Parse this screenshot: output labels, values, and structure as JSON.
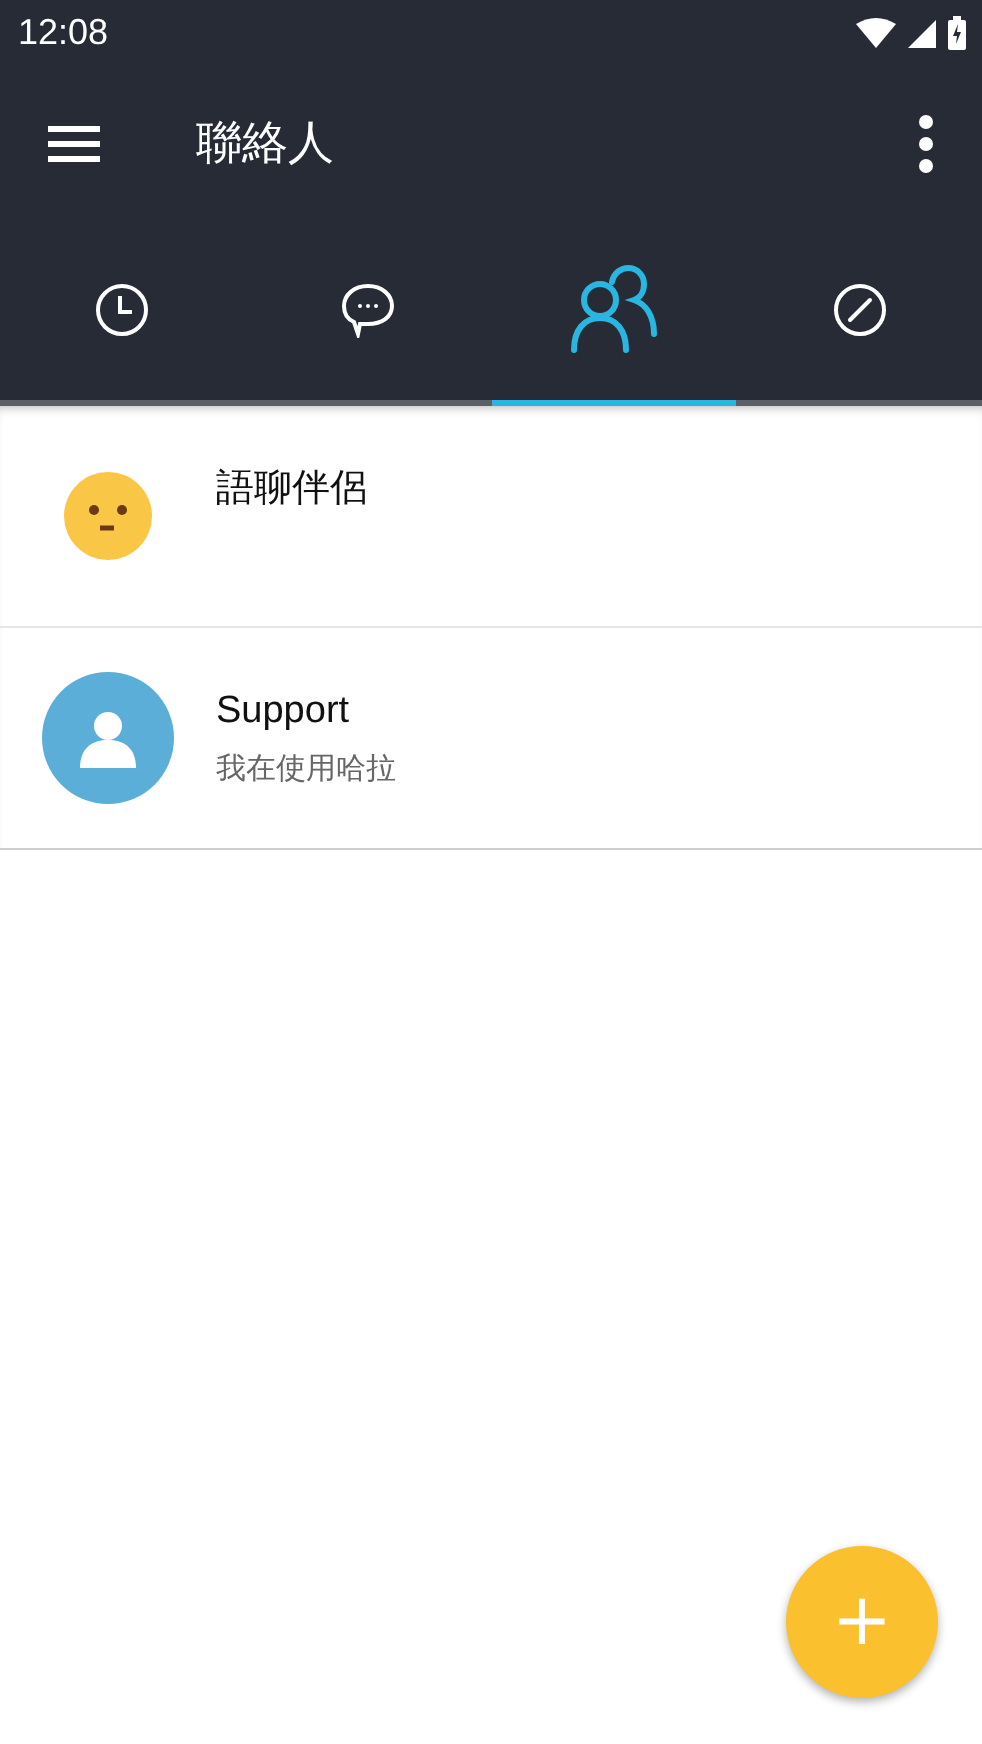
{
  "status_bar": {
    "time": "12:08"
  },
  "toolbar": {
    "title": "聯絡人"
  },
  "tabs": [
    {
      "kind": "clock",
      "selected": false
    },
    {
      "kind": "chat",
      "selected": false
    },
    {
      "kind": "people",
      "selected": true
    },
    {
      "kind": "compass",
      "selected": false
    }
  ],
  "contacts": [
    {
      "kind": "smiley",
      "name": "語聊伴侶"
    },
    {
      "kind": "person",
      "name": "Support",
      "status": "我在使用哈拉"
    }
  ],
  "fab": {
    "icon": "+"
  }
}
